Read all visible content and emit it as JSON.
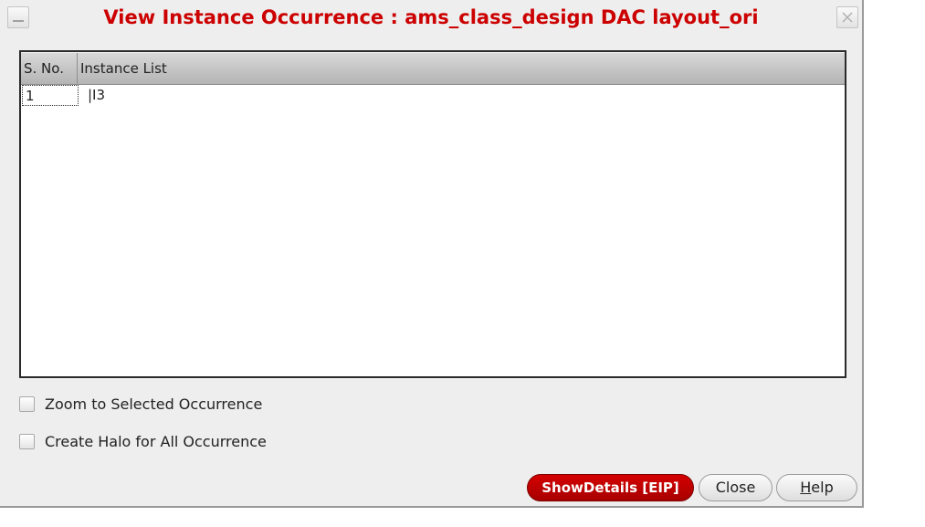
{
  "window": {
    "title": "View Instance Occurrence : ams_class_design DAC layout_ori",
    "title_color": "#cc0000"
  },
  "table": {
    "columns": [
      "S. No.",
      "Instance List"
    ],
    "rows": [
      {
        "sno": "1",
        "instance": "|I3"
      }
    ]
  },
  "options": {
    "zoom_label": "Zoom to Selected Occurrence",
    "zoom_checked": false,
    "halo_label": "Create Halo for All Occurrence",
    "halo_checked": false
  },
  "buttons": {
    "details": "ShowDetails [EIP]",
    "close": "Close",
    "help_first": "H",
    "help_rest": "elp",
    "details_color": "#c00000"
  }
}
